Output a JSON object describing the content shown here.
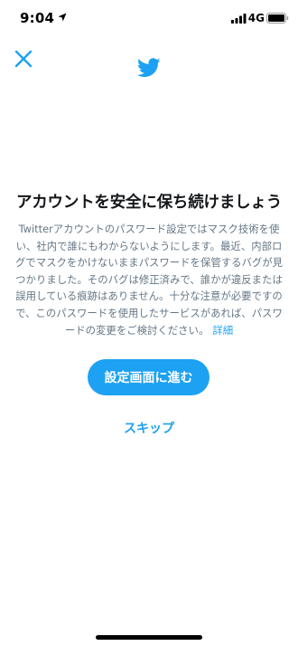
{
  "status_bar": {
    "time": "9:04",
    "network": "4G",
    "icons": [
      "location-arrow-icon",
      "signal-bars-icon",
      "battery-icon"
    ]
  },
  "header": {
    "close_icon": "close-icon",
    "logo_icon": "twitter-bird-icon"
  },
  "main": {
    "title": "アカウントを安全に保ち続けましょう",
    "body": "Twitterアカウントのパスワード設定ではマスク技術を使い、社内で誰にもわからないようにします。最近、内部ログでマスクをかけないままパスワードを保管するバグが見つかりました。そのバグは修正済みで、誰かが違反または誤用している痕跡はありません。十分な注意が必要ですので、このパスワードを使用したサービスがあれば、パスワードの変更をご検討ください。",
    "details_link": "詳細",
    "primary_button": "設定画面に進む",
    "skip_link": "スキップ"
  },
  "colors": {
    "accent": "#1da1f2",
    "title": "#14171a",
    "body_text": "#657786",
    "background": "#ffffff"
  }
}
